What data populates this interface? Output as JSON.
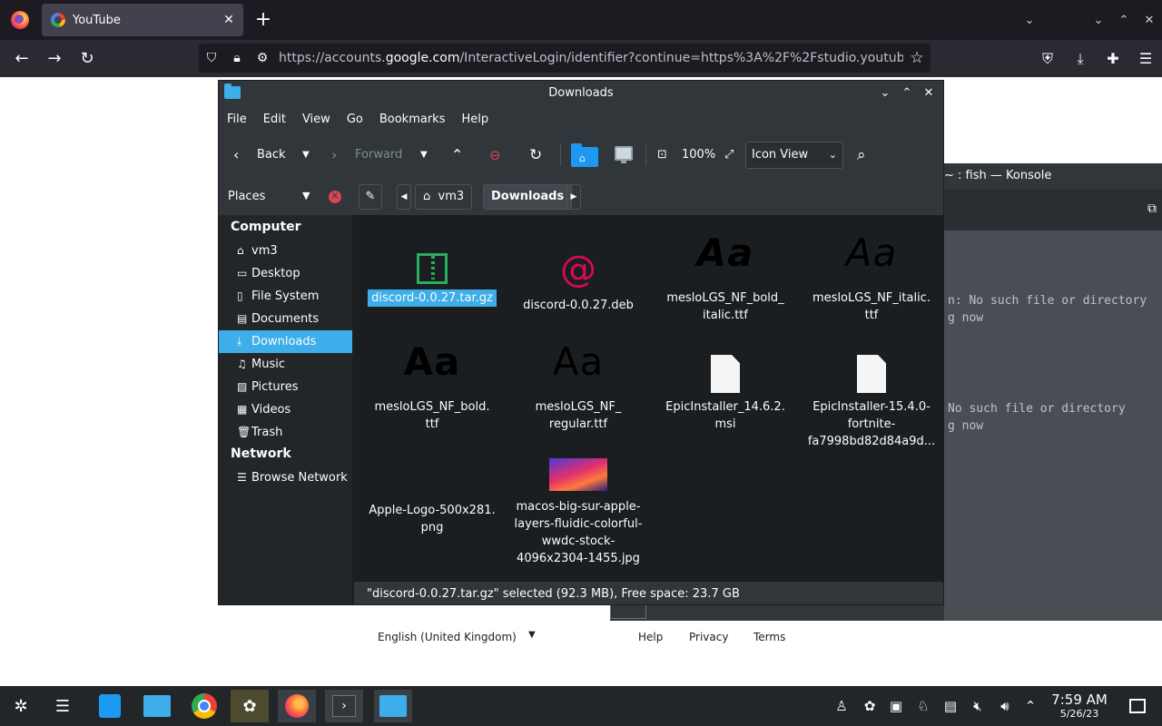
{
  "browser": {
    "tab_title": "YouTube",
    "tab_close": "✕",
    "new_tab": "+",
    "url_prefix": "https://accounts.",
    "url_domain": "google.com",
    "url_rest": "/InteractiveLogin/identifier?continue=https%3A%2F%2Fstudio.youtube.com"
  },
  "page": {
    "language": "English (United Kingdom)",
    "links": [
      "Help",
      "Privacy",
      "Terms"
    ]
  },
  "konsole": {
    "title": "~ : fish — Konsole",
    "lines": [
      "n: No such file or directory",
      "g now",
      "No such file or directory",
      "g now"
    ]
  },
  "dolphin": {
    "title": "Downloads",
    "menu": [
      "File",
      "Edit",
      "View",
      "Go",
      "Bookmarks",
      "Help"
    ],
    "toolbar": {
      "back": "Back",
      "forward": "Forward",
      "zoom": "100%",
      "view_mode": "Icon View"
    },
    "places_label": "Places",
    "breadcrumb": [
      "vm3",
      "Downloads"
    ],
    "sidebar": {
      "computer_heading": "Computer",
      "computer_items": [
        "vm3",
        "Desktop",
        "File System",
        "Documents",
        "Downloads",
        "Music",
        "Pictures",
        "Videos",
        "Trash"
      ],
      "network_heading": "Network",
      "network_items": [
        "Browse Network"
      ]
    },
    "files": [
      {
        "name": "discord-0.0.27.tar.gz",
        "icon": "archive-icon"
      },
      {
        "name": "discord-0.0.27.deb",
        "icon": "debian-icon"
      },
      {
        "name": "mesloLGS_NF_bold_\nitalic.ttf",
        "icon": "font-icon"
      },
      {
        "name": "mesloLGS_NF_italic.\nttf",
        "icon": "font-icon"
      },
      {
        "name": "mesloLGS_NF_bold.\nttf",
        "icon": "font-icon"
      },
      {
        "name": "mesloLGS_NF_\nregular.ttf",
        "icon": "font-icon"
      },
      {
        "name": "EpicInstaller_14.6.2.\nmsi",
        "icon": "document-icon"
      },
      {
        "name": "EpicInstaller-15.4.0-\nfortnite-\nfa7998bd82d84a9d...",
        "icon": "document-icon"
      },
      {
        "name": "Apple-Logo-500x281.\npng",
        "icon": "apple-icon"
      },
      {
        "name": "macos-big-sur-apple-\nlayers-fluidic-colorful-\nwwdc-stock-\n4096x2304-1455.jpg",
        "icon": "image-icon"
      }
    ],
    "font_preview": "Aa",
    "status": "\"discord-0.0.27.tar.gz\" selected (92.3 MB), Free space: 23.7 GB"
  },
  "taskbar": {
    "time": "7:59 AM",
    "date": "5/26/23"
  },
  "colors": {
    "selection": "#3daee9",
    "window_bg": "#31363b",
    "view_bg": "#1b1e20"
  }
}
